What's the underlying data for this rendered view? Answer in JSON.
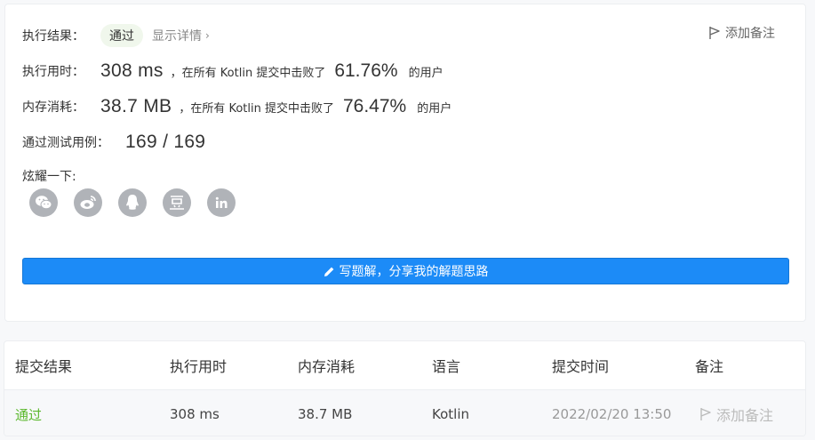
{
  "result": {
    "label": "执行结果：",
    "status": "通过",
    "details_link": "显示详情",
    "add_note": "添加备注"
  },
  "runtime": {
    "label": "执行用时：",
    "value": "308 ms",
    "prefix": "，在所有 Kotlin 提交中击败了",
    "percent": "61.76%",
    "suffix": "的用户"
  },
  "memory": {
    "label": "内存消耗：",
    "value": "38.7 MB",
    "prefix": "，在所有 Kotlin 提交中击败了",
    "percent": "76.47%",
    "suffix": "的用户"
  },
  "testcases": {
    "label": "通过测试用例：",
    "value": "169 / 169"
  },
  "share": {
    "label": "炫耀一下:",
    "icons": [
      "wechat-icon",
      "weibo-icon",
      "qq-icon",
      "douban-icon",
      "linkedin-icon"
    ]
  },
  "write_button": "写题解，分享我的解题思路",
  "table": {
    "headers": [
      "提交结果",
      "执行用时",
      "内存消耗",
      "语言",
      "提交时间",
      "备注"
    ],
    "row": {
      "result": "通过",
      "runtime": "308 ms",
      "memory": "38.7 MB",
      "language": "Kotlin",
      "time": "2022/02/20 13:50",
      "note": "添加备注"
    }
  },
  "colors": {
    "accent": "#1c8bf7",
    "pass": "#5cb82e",
    "icon_gray": "#b0b3b8"
  }
}
